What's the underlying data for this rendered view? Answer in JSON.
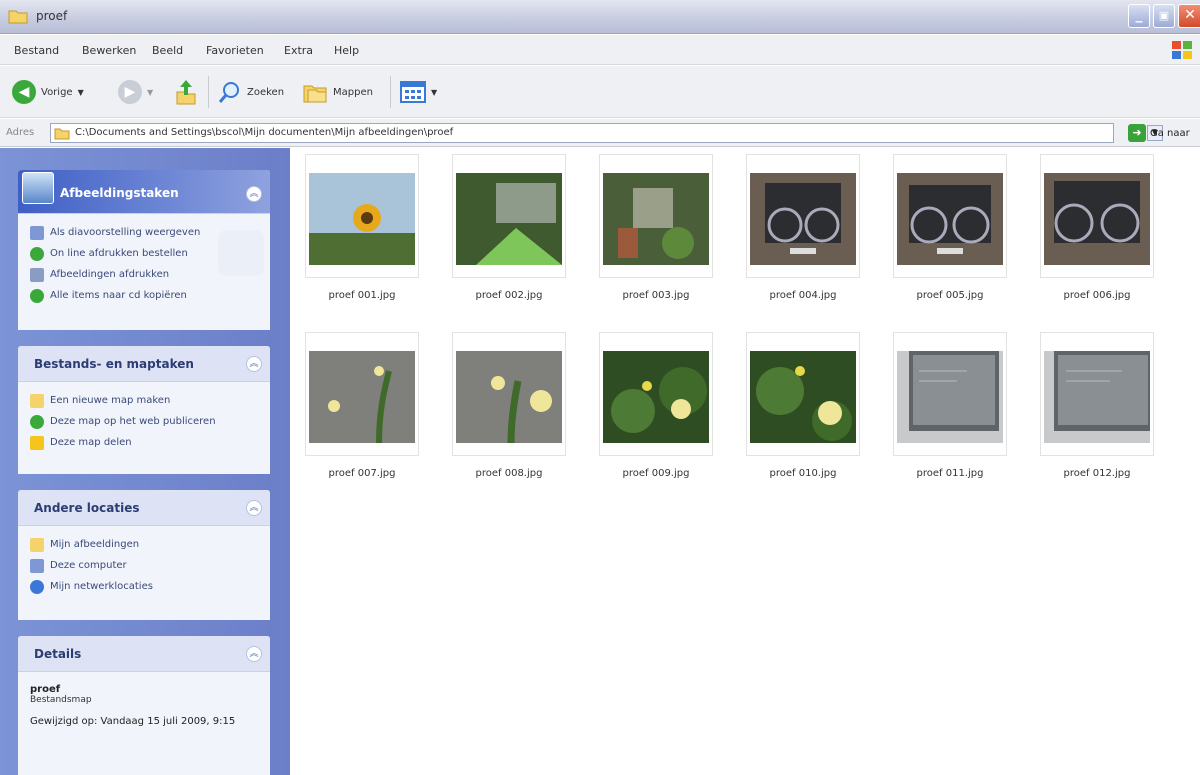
{
  "window": {
    "title": "proef"
  },
  "menu": [
    "Bestand",
    "Bewerken",
    "Beeld",
    "Favorieten",
    "Extra",
    "Help"
  ],
  "toolbar": {
    "back": "Vorige",
    "search": "Zoeken",
    "folders": "Mappen"
  },
  "address": {
    "label": "Adres",
    "path": "C:\\Documents and Settings\\bscol\\Mijn documenten\\Mijn afbeeldingen\\proef",
    "go": "Ga naar"
  },
  "panels": {
    "picture_tasks": {
      "title": "Afbeeldingstaken",
      "items": [
        "Als diavoorstelling weergeven",
        "On line afdrukken bestellen",
        "Afbeeldingen afdrukken",
        "Alle items naar cd kopiëren"
      ]
    },
    "file_tasks": {
      "title": "Bestands- en maptaken",
      "items": [
        "Een nieuwe map maken",
        "Deze map op het web publiceren",
        "Deze map delen"
      ]
    },
    "other_places": {
      "title": "Andere locaties",
      "items": [
        "Mijn afbeeldingen",
        "Deze computer",
        "Mijn netwerklocaties"
      ]
    },
    "details": {
      "title": "Details",
      "name": "proef",
      "type": "Bestandsmap",
      "date": "Gewijzigd op: Vandaag 15 juli 2009, 9:15"
    }
  },
  "files": [
    {
      "name": "proef 001.jpg",
      "thumb": "sunflower"
    },
    {
      "name": "proef 002.jpg",
      "thumb": "garden"
    },
    {
      "name": "proef 003.jpg",
      "thumb": "garden-path"
    },
    {
      "name": "proef 004.jpg",
      "thumb": "bike-rack"
    },
    {
      "name": "proef 005.jpg",
      "thumb": "bike-rack"
    },
    {
      "name": "proef 006.jpg",
      "thumb": "bike-rack"
    },
    {
      "name": "proef 007.jpg",
      "thumb": "roses-wall"
    },
    {
      "name": "proef 008.jpg",
      "thumb": "roses-wall"
    },
    {
      "name": "proef 009.jpg",
      "thumb": "roses-green"
    },
    {
      "name": "proef 010.jpg",
      "thumb": "roses-green"
    },
    {
      "name": "proef 011.jpg",
      "thumb": "screen"
    },
    {
      "name": "proef 012.jpg",
      "thumb": "screen"
    }
  ]
}
